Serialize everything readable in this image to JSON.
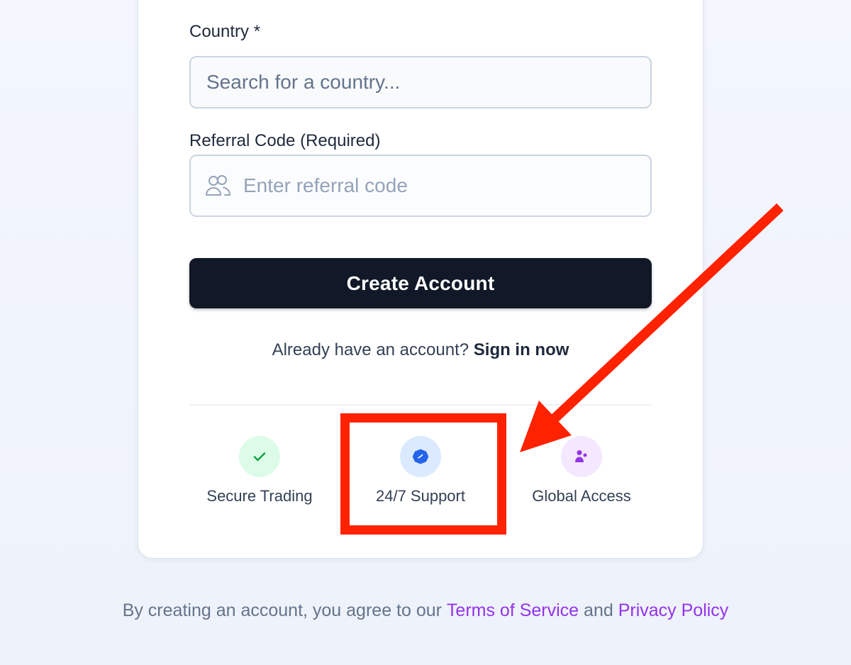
{
  "form": {
    "country": {
      "label": "Country *",
      "placeholder": "Search for a country..."
    },
    "referral": {
      "label": "Referral Code (Required)",
      "placeholder": "Enter referral code",
      "icon": "users-icon"
    },
    "submit_label": "Create Account",
    "signin_prompt": "Already have an account?",
    "signin_link": "Sign in now"
  },
  "features": [
    {
      "label": "Secure Trading",
      "icon": "check-icon",
      "color": "#16a34a",
      "bg": "#dcfce7"
    },
    {
      "label": "24/7 Support",
      "icon": "clock-icon",
      "color": "#2563eb",
      "bg": "#dbeafe"
    },
    {
      "label": "Global Access",
      "icon": "user-group-icon",
      "color": "#9333ea",
      "bg": "#f3e8ff"
    }
  ],
  "footer": {
    "prefix": "By creating an account, you agree to our",
    "terms_link": "Terms of Service",
    "and": "and",
    "privacy_link": "Privacy Policy"
  },
  "annotation": {
    "highlight_color": "#ff2200",
    "highlight_target": "24/7 Support"
  },
  "colors": {
    "button_bg": "#111827",
    "link_accent": "#9333ea"
  }
}
